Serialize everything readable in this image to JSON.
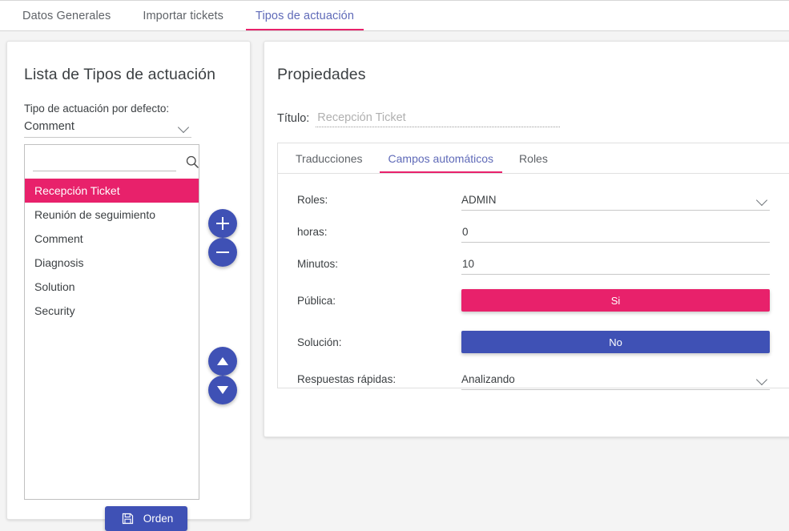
{
  "topbar": {
    "tabs": [
      {
        "label": "Datos Generales",
        "active": false
      },
      {
        "label": "Importar tickets",
        "active": false
      },
      {
        "label": "Tipos de actuación",
        "active": true
      }
    ]
  },
  "left_panel": {
    "title": "Lista de Tipos de actuación",
    "default_type_label": "Tipo de actuación por defecto:",
    "default_type_value": "Comment",
    "search": {
      "value": "",
      "placeholder": "",
      "icon": "search-icon"
    },
    "items": [
      {
        "label": "Recepción Ticket",
        "selected": true
      },
      {
        "label": "Reunión de seguimiento",
        "selected": false
      },
      {
        "label": "Comment",
        "selected": false
      },
      {
        "label": "Diagnosis",
        "selected": false
      },
      {
        "label": "Solution",
        "selected": false
      },
      {
        "label": "Security",
        "selected": false
      }
    ],
    "side_buttons": [
      {
        "name": "add-button",
        "icon": "plus-icon"
      },
      {
        "name": "remove-button",
        "icon": "minus-icon"
      },
      {
        "name": "move-up-button",
        "icon": "arrow-up-icon"
      },
      {
        "name": "move-down-button",
        "icon": "arrow-down-icon"
      }
    ],
    "order_button": {
      "label": "Orden",
      "icon": "save-floppy-icon"
    }
  },
  "right_panel": {
    "title": "Propiedades",
    "titulo_label": "Título:",
    "titulo_value": "",
    "titulo_placeholder": "Recepción Ticket",
    "tabs": [
      {
        "label": "Traducciones",
        "active": false
      },
      {
        "label": "Campos automáticos",
        "active": true
      },
      {
        "label": "Roles",
        "active": false
      }
    ],
    "fields": [
      {
        "label": "Roles:",
        "type": "select",
        "value": "ADMIN"
      },
      {
        "label": "horas:",
        "type": "text",
        "value": "0"
      },
      {
        "label": "Minutos:",
        "type": "text",
        "value": "10"
      },
      {
        "label": "Pública:",
        "type": "toggle",
        "value": "Si",
        "color": "#e8216b"
      },
      {
        "label": "Solución:",
        "type": "toggle",
        "value": "No",
        "color": "#3f51b5"
      },
      {
        "label": "Respuestas rápidas:",
        "type": "select",
        "value": "Analizando"
      }
    ]
  },
  "colors": {
    "accent_pink": "#e8216b",
    "accent_blue": "#3f51b5",
    "page_background": "#f4f4f4",
    "card_background": "#ffffff"
  }
}
